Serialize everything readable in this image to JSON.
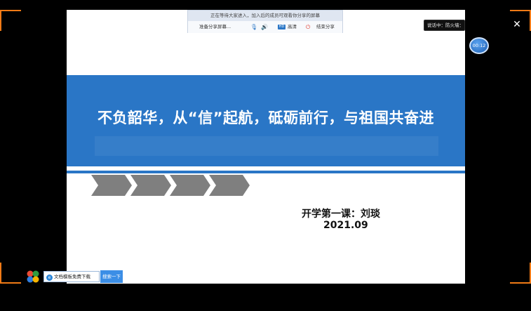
{
  "slide": {
    "title": "不负韶华，从“信”起航，砥砺前行，与祖国共奋进",
    "subtitle_course": "开学第一课：刘琰",
    "subtitle_date": "2021.09",
    "band_color": "#2a76c6",
    "chevron_color": "#7f7f7f",
    "chevron_count": 4
  },
  "share_banner": {
    "message": "正在等待大家进入，加入后的成员可观看你分享的屏幕",
    "quality_label": "准备分享屏幕...",
    "mic_icon": "microphone-icon",
    "speaker_icon": "speaker-icon",
    "hd_badge": "HD",
    "hd_label": "高清",
    "stop_icon": "power-icon",
    "stop_label": "结束分享"
  },
  "overlay": {
    "talking_label": "说话中：防火墙：",
    "close_icon": "close-icon",
    "timer": "00:12",
    "accent_color": "#f07a16"
  },
  "taskbar": {
    "app_icon": "360-pinwheel-icon",
    "search_text": "文档模板免费下载",
    "search_button": "搜索一下"
  }
}
